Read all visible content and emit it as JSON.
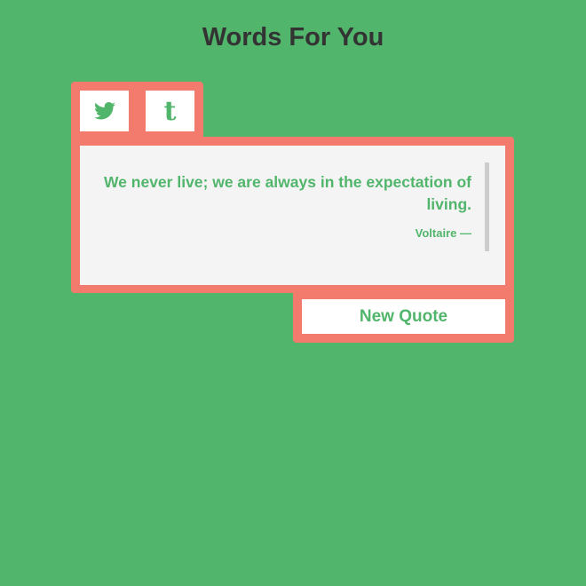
{
  "header": {
    "title": "Words For You"
  },
  "share": {
    "twitter_icon": "twitter-icon",
    "tumblr_icon": "tumblr-icon",
    "tumblr_glyph": "t"
  },
  "quote": {
    "text": "We never live; we are always in the expectation of living.",
    "author": "Voltaire —"
  },
  "actions": {
    "new_quote_label": "New Quote"
  },
  "colors": {
    "background": "#52b56c",
    "accent": "#f27b6e",
    "panel": "#f4f4f4",
    "text": "#52b56c"
  }
}
